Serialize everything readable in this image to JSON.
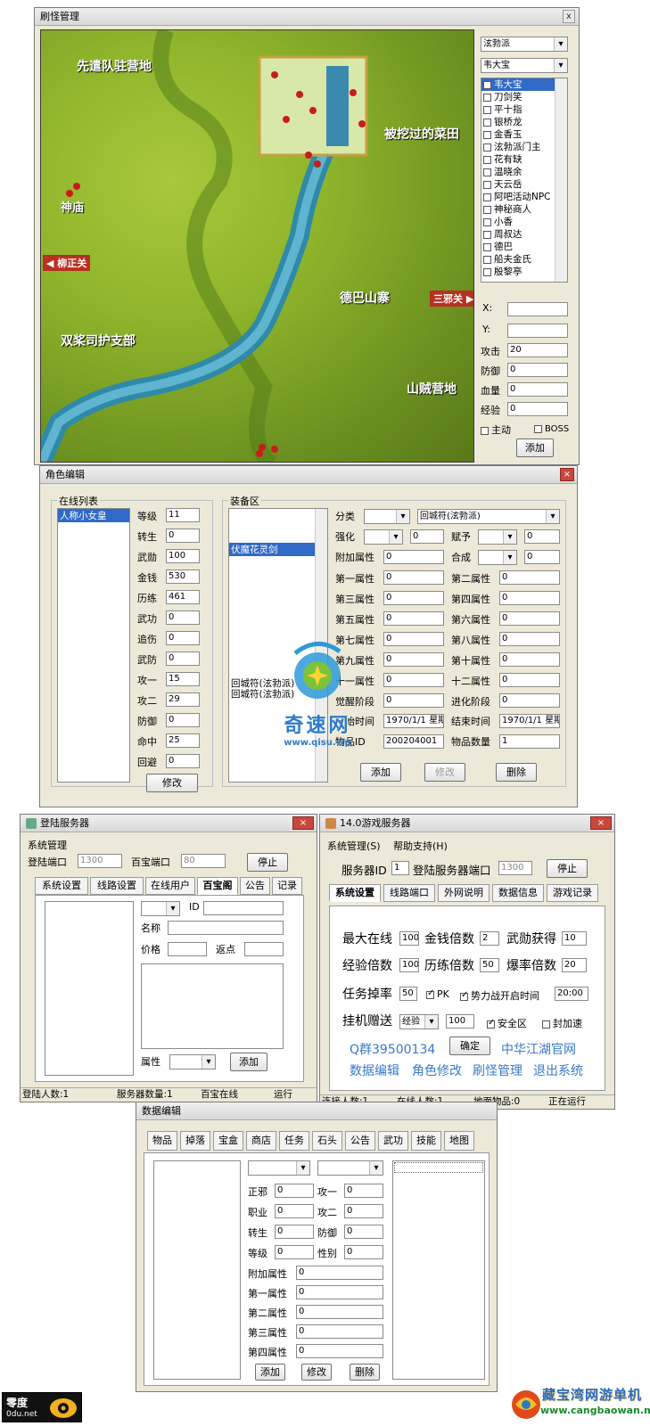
{
  "monster_win": {
    "title": "刷怪管理",
    "close": "x",
    "map_labels": [
      "先遣队驻营地",
      "被挖过的菜田",
      "神庙",
      "柳正关",
      "三邪关",
      "德巴山寨",
      "双桨司护支部",
      "山贼营地"
    ],
    "dropdown1": "泫勃派",
    "dropdown2": "韦大宝",
    "npc_list": [
      "韦大宝",
      "刀剑笑",
      "平十指",
      "银桥龙",
      "金香玉",
      "泫勃派门主",
      "花有缺",
      "温晓余",
      "天云岳",
      "阿吧活动NPC",
      "神秘商人",
      "小香",
      "周叔达",
      "德巴",
      "船夫金氏",
      "殷黎亭"
    ],
    "x_label": "X:",
    "y_label": "Y:",
    "attack_label": "攻击",
    "attack_value": "20",
    "defense_label": "防御",
    "defense_value": "0",
    "hp_label": "血量",
    "hp_value": "0",
    "exp_label": "经验",
    "exp_value": "0",
    "active_label": "主动",
    "boss_label": "BOSS",
    "add_button": "添加"
  },
  "char_win": {
    "title": "角色编辑",
    "online_group": "在线列表",
    "online_user": "人称小女皇",
    "stats": [
      {
        "label": "等级",
        "value": "11"
      },
      {
        "label": "转生",
        "value": "0"
      },
      {
        "label": "武勋",
        "value": "100"
      },
      {
        "label": "金钱",
        "value": "530"
      },
      {
        "label": "历练",
        "value": "461"
      },
      {
        "label": "武功",
        "value": "0"
      },
      {
        "label": "追伤",
        "value": "0"
      },
      {
        "label": "武防",
        "value": "0"
      },
      {
        "label": "攻一",
        "value": "15"
      },
      {
        "label": "攻二",
        "value": "29"
      },
      {
        "label": "防御",
        "value": "0"
      },
      {
        "label": "命中",
        "value": "25"
      },
      {
        "label": "回避",
        "value": "0"
      }
    ],
    "modify_button": "修改",
    "equip_group": "装备区",
    "equip_items": [
      "伏魔花灵剑",
      "回城符(泫勃派)",
      "回城符(泫勃派)"
    ],
    "category_label": "分类",
    "category_value": "回城符(泫勃派)",
    "enhance_label": "强化",
    "enhance_value": "0",
    "grant_label": "赋予",
    "grant_value": "0",
    "extra_label": "附加属性",
    "extra_value": "0",
    "combine_label": "合成",
    "combine_value": "0",
    "attrs_left": [
      {
        "label": "第一属性",
        "value": "0"
      },
      {
        "label": "第三属性",
        "value": "0"
      },
      {
        "label": "第五属性",
        "value": "0"
      },
      {
        "label": "第七属性",
        "value": "0"
      },
      {
        "label": "第九属性",
        "value": "0"
      },
      {
        "label": "十一属性",
        "value": "0"
      },
      {
        "label": "觉醒阶段",
        "value": "0"
      }
    ],
    "attrs_right": [
      {
        "label": "第二属性",
        "value": "0"
      },
      {
        "label": "第四属性",
        "value": "0"
      },
      {
        "label": "第六属性",
        "value": "0"
      },
      {
        "label": "第八属性",
        "value": "0"
      },
      {
        "label": "第十属性",
        "value": "0"
      },
      {
        "label": "十二属性",
        "value": "0"
      },
      {
        "label": "进化阶段",
        "value": "0"
      }
    ],
    "start_label": "开始时间",
    "start_value": "1970/1/1 星期",
    "end_label": "结束时间",
    "end_value": "1970/1/1 星期",
    "id_label": "物品ID",
    "id_value": "200204001",
    "qty_label": "物品数量",
    "qty_value": "1",
    "add_button": "添加",
    "edit_button": "修改",
    "delete_button": "删除",
    "watermark_name": "奇速网",
    "watermark_url": "www.qisu.vip"
  },
  "login_win": {
    "title": "登陆服务器",
    "menu": "系统管理",
    "port_label": "登陆端口",
    "port_value": "1300",
    "shop_port_label": "百宝端口",
    "shop_port_value": "80",
    "stop_button": "停止",
    "tabs": [
      "系统设置",
      "线路设置",
      "在线用户",
      "百宝阁",
      "公告",
      "记录"
    ],
    "id_label": "ID",
    "name_label": "名称",
    "price_label": "价格",
    "rebate_label": "返点",
    "attr_label": "属性",
    "add_button": "添加",
    "status": [
      "登陆人数:1",
      "服务器数量:1",
      "百宝在线",
      "运行"
    ]
  },
  "game_win": {
    "title": "14.0游戏服务器",
    "menu": [
      "系统管理(S)",
      "帮助支持(H)"
    ],
    "server_id_label": "服务器ID",
    "server_id_value": "1",
    "login_port_label": "登陆服务器端口",
    "login_port_value": "1300",
    "stop_button": "停止",
    "tabs": [
      "系统设置",
      "线路端口",
      "外网说明",
      "数据信息",
      "游戏记录"
    ],
    "max_online_label": "最大在线",
    "max_online_value": "100",
    "gold_mult_label": "金钱倍数",
    "gold_mult_value": "2",
    "honor_label": "武勋获得",
    "honor_value": "10",
    "exp_mult_label": "经验倍数",
    "exp_mult_value": "100",
    "practice_mult_label": "历练倍数",
    "practice_mult_value": "50",
    "drop_mult_label": "爆率倍数",
    "drop_mult_value": "20",
    "quest_drop_label": "任务掉率",
    "quest_drop_value": "50",
    "pk_label": "PK",
    "faction_war_label": "势力战开启时间",
    "faction_war_value": "20:00",
    "idle_gift_label": "挂机赠送",
    "idle_gift_type": "经验",
    "idle_gift_value": "100",
    "safe_zone_label": "安全区",
    "speed_block_label": "封加速",
    "qq_group": "Q群39500134",
    "confirm_button": "确定",
    "official_site": "中华江湖官网",
    "links": [
      "数据编辑",
      "角色修改",
      "刷怪管理",
      "退出系统"
    ],
    "status": [
      "连接人数:1",
      "在线人数:1",
      "地面物品:0",
      "正在运行"
    ]
  },
  "data_win": {
    "title": "数据编辑",
    "tabs": [
      "物品",
      "掉落",
      "宝盒",
      "商店",
      "任务",
      "石头",
      "公告",
      "武功",
      "技能",
      "地图"
    ],
    "fields_left": [
      {
        "label": "正邪",
        "value": "0"
      },
      {
        "label": "职业",
        "value": "0"
      },
      {
        "label": "转生",
        "value": "0"
      },
      {
        "label": "等级",
        "value": "0"
      }
    ],
    "fields_right": [
      {
        "label": "攻一",
        "value": "0"
      },
      {
        "label": "攻二",
        "value": "0"
      },
      {
        "label": "防御",
        "value": "0"
      },
      {
        "label": "性别",
        "value": "0"
      }
    ],
    "fields_wide": [
      {
        "label": "附加属性",
        "value": "0"
      },
      {
        "label": "第一属性",
        "value": "0"
      },
      {
        "label": "第二属性",
        "value": "0"
      },
      {
        "label": "第三属性",
        "value": "0"
      },
      {
        "label": "第四属性",
        "value": "0"
      }
    ],
    "add_button": "添加",
    "edit_button": "修改",
    "delete_button": "删除"
  },
  "footer": {
    "left_logo": "零度",
    "left_logo_sub": "0du.net",
    "right_logo": "藏宝湾网游单机",
    "right_url": "www.cangbaowan.net"
  }
}
